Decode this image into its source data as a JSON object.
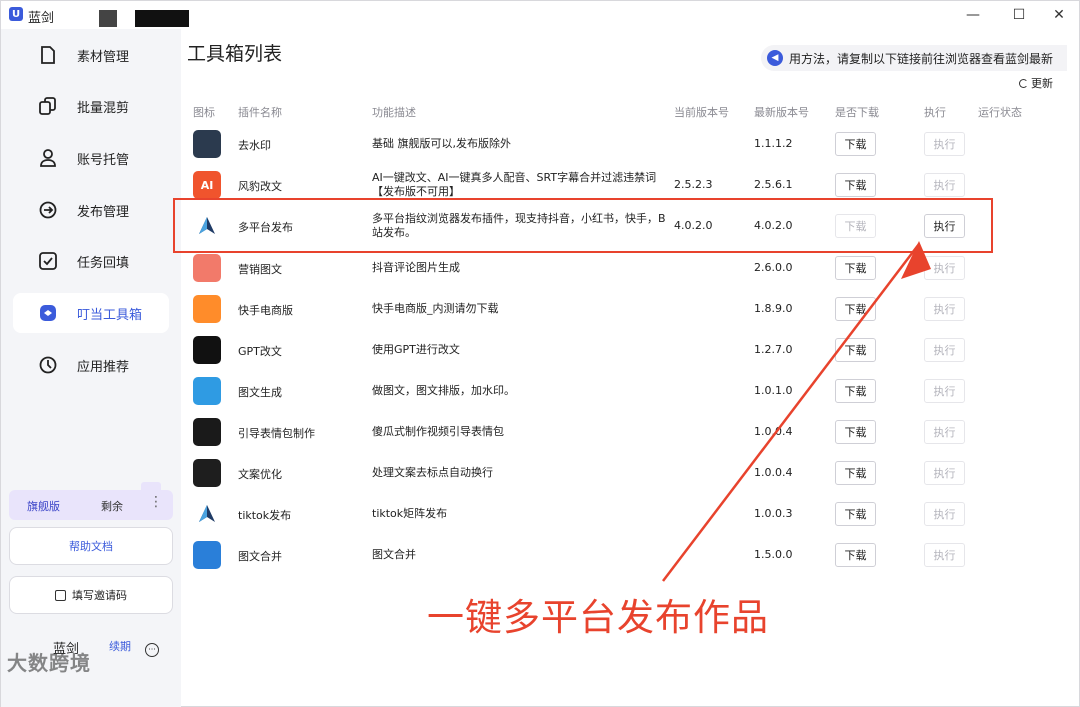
{
  "window": {
    "title": "蓝剑",
    "controls": {
      "minimize": "—",
      "maximize": "☐",
      "close": "✕"
    }
  },
  "sidebar": {
    "items": [
      {
        "label": "素材管理",
        "icon": "file-icon"
      },
      {
        "label": "批量混剪",
        "icon": "copy-icon"
      },
      {
        "label": "账号托管",
        "icon": "user-icon"
      },
      {
        "label": "发布管理",
        "icon": "publish-icon"
      },
      {
        "label": "任务回填",
        "icon": "checkbox-icon"
      },
      {
        "label": "叮当工具箱",
        "icon": "toolbox-icon",
        "active": true
      },
      {
        "label": "应用推荐",
        "icon": "compass-icon"
      }
    ],
    "plan": {
      "name": "旗舰版",
      "remaining": "剩余",
      "more": "⋮"
    },
    "help_label": "帮助文档",
    "invite_label": "填写邀请码",
    "user": {
      "name": "蓝剑",
      "badge": "续期",
      "more": "···"
    },
    "watermark": "大数跨境"
  },
  "main": {
    "title": "工具箱列表",
    "notice": "用方法，请复制以下链接前往浏览器查看蓝剑最新",
    "refresh_label": "更新",
    "columns": [
      "图标",
      "插件名称",
      "功能描述",
      "当前版本号",
      "最新版本号",
      "是否下载",
      "执行",
      "运行状态"
    ],
    "rows": [
      {
        "name": "去水印",
        "desc": "基础 旗舰版可以,发布版除外",
        "current": "",
        "latest": "1.1.1.2",
        "download": "下载",
        "download_disabled": false,
        "run": "执行",
        "run_disabled": true,
        "icon": "watermark-remove-icon",
        "icon_color": "#2b3a4e",
        "icon_text": ""
      },
      {
        "name": "风豹改文",
        "desc": "AI一键改文、AI一键真多人配音、SRT字幕合并过滤违禁词【发布版不可用】",
        "current": "2.5.2.3",
        "latest": "2.5.6.1",
        "download": "下载",
        "download_disabled": false,
        "run": "执行",
        "run_disabled": true,
        "icon": "ai-icon",
        "icon_color": "#f0542d",
        "icon_text": "AI"
      },
      {
        "name": "多平台发布",
        "desc": "多平台指纹浏览器发布插件，现支持抖音，小红书，快手，B站发布。",
        "current": "4.0.2.0",
        "latest": "4.0.2.0",
        "download": "下载",
        "download_disabled": true,
        "run": "执行",
        "run_disabled": false,
        "icon": "send-icon",
        "icon_color": "#ffffff",
        "icon_text": ""
      },
      {
        "name": "营销图文",
        "desc": "抖音评论图片生成",
        "current": "",
        "latest": "2.6.0.0",
        "download": "下载",
        "download_disabled": false,
        "run": "执行",
        "run_disabled": true,
        "icon": "marketing-icon",
        "icon_color": "#f27a6a",
        "icon_text": ""
      },
      {
        "name": "快手电商版",
        "desc": "快手电商版_内测请勿下载",
        "current": "",
        "latest": "1.8.9.0",
        "download": "下载",
        "download_disabled": false,
        "run": "执行",
        "run_disabled": true,
        "icon": "kuaishou-icon",
        "icon_color": "#ff8c2a",
        "icon_text": ""
      },
      {
        "name": "GPT改文",
        "desc": "使用GPT进行改文",
        "current": "",
        "latest": "1.2.7.0",
        "download": "下载",
        "download_disabled": false,
        "run": "执行",
        "run_disabled": true,
        "icon": "gpt-icon",
        "icon_color": "#111111",
        "icon_text": ""
      },
      {
        "name": "图文生成",
        "desc": "做图文，图文排版，加水印。",
        "current": "",
        "latest": "1.0.1.0",
        "download": "下载",
        "download_disabled": false,
        "run": "执行",
        "run_disabled": true,
        "icon": "image-icon",
        "icon_color": "#2f9be3",
        "icon_text": ""
      },
      {
        "name": "引导表情包制作",
        "desc": "傻瓜式制作视频引导表情包",
        "current": "",
        "latest": "1.0.0.4",
        "download": "下载",
        "download_disabled": false,
        "run": "执行",
        "run_disabled": true,
        "icon": "emoji-icon",
        "icon_color": "#1a1a1a",
        "icon_text": ""
      },
      {
        "name": "文案优化",
        "desc": "处理文案去标点自动换行",
        "current": "",
        "latest": "1.0.0.4",
        "download": "下载",
        "download_disabled": false,
        "run": "执行",
        "run_disabled": true,
        "icon": "copywriting-icon",
        "icon_color": "#1e1e1e",
        "icon_text": ""
      },
      {
        "name": "tiktok发布",
        "desc": "tiktok矩阵发布",
        "current": "",
        "latest": "1.0.0.3",
        "download": "下载",
        "download_disabled": false,
        "run": "执行",
        "run_disabled": true,
        "icon": "send-icon",
        "icon_color": "#ffffff",
        "icon_text": ""
      },
      {
        "name": "图文合并",
        "desc": "图文合并",
        "current": "",
        "latest": "1.5.0.0",
        "download": "下载",
        "download_disabled": false,
        "run": "执行",
        "run_disabled": true,
        "icon": "layers-icon",
        "icon_color": "#2a7fd9",
        "icon_text": ""
      }
    ]
  },
  "annotation": {
    "text": "一键多平台发布作品",
    "color": "#e8432d"
  }
}
